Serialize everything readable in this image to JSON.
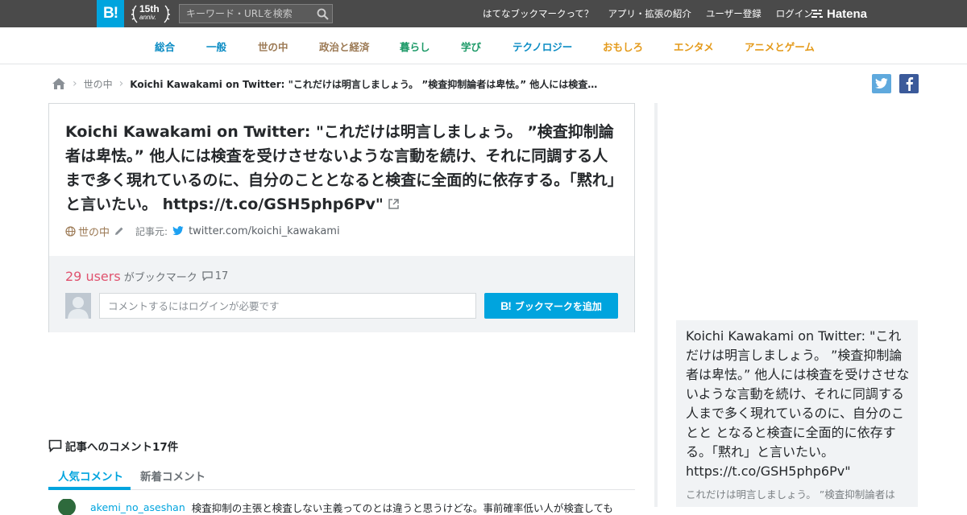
{
  "header": {
    "logo_text": "B!",
    "anniv_number": "15th",
    "anniv_text": "anniv.",
    "search_placeholder": "キーワード・URLを検索",
    "links": [
      "はてなブックマークって？",
      "アプリ・拡張の紹介",
      "ユーザー登録",
      "ログイン"
    ],
    "hatena_logo": "Hatena",
    "bar_color": "#4a4a4a",
    "accent": "#00a4de"
  },
  "categories": [
    {
      "label": "総合",
      "color": "#0b8cc4"
    },
    {
      "label": "一般",
      "color": "#0b8cc4"
    },
    {
      "label": "世の中",
      "color": "#9c7a55"
    },
    {
      "label": "政治と経済",
      "color": "#9c7a55"
    },
    {
      "label": "暮らし",
      "color": "#1d9a68"
    },
    {
      "label": "学び",
      "color": "#1d9a68"
    },
    {
      "label": "テクノロジー",
      "color": "#0b8cc4"
    },
    {
      "label": "おもしろ",
      "color": "#e49a1a"
    },
    {
      "label": "エンタメ",
      "color": "#e49a1a"
    },
    {
      "label": "アニメとゲーム",
      "color": "#e49a1a"
    }
  ],
  "breadcrumb": {
    "home_icon": "home-icon",
    "category": "世の中",
    "current": "Koichi Kawakami on Twitter: \"これだけは明言しましょう。 ”検査抑制論者は卑怯。” 他人には検査を受けさせないような言動を続け、それに同調する人まで多く現れているのに、自分のこととなると検査に全面的に依存する。「黙れ」と言いたい。 https://t.co/GSH5php6Pv\""
  },
  "entry": {
    "title": "Koichi Kawakami on Twitter: \"これだけは明言しましょう。 ”検査抑制論者は卑怯。” 他人には検査を受けさせないような言動を続け、それに同調する人まで多く現れているのに、自分のこととなると検査に全面的に依存する。「黙れ」と言いたい。 https://t.co/GSH5php6Pv\"",
    "category": "世の中",
    "source_label": "記事元:",
    "source_domain": "twitter.com/koichi_kawakami",
    "users_count": "29 users",
    "users_label": "がブックマーク",
    "comment_count": "17",
    "comment_placeholder": "コメントするにはログインが必要です",
    "add_button_icon": "B!",
    "add_button_label": "ブックマークを追加"
  },
  "side": {
    "title": "Koichi Kawakami on Twitter: \"これだけは明言しましょう。 ”検査抑制論者は卑怯。” 他人には検査を受けさせないような言動を続け、それに同調する人まで多く現れているのに、自分のことと\nとなると検査に全面的に依存する。「黙れ」と言いたい。 https://t.co/GSH5php6Pv\"",
    "snippet": "これだけは明言しましょう。 ”検査抑制論者は"
  },
  "comments": {
    "heading": "記事へのコメント17件",
    "tabs": [
      "人気コメント",
      "新着コメント"
    ],
    "first": {
      "user": "akemi_no_aseshan",
      "text": "検査抑制の主張と検査しない主義ってのとは違うと思うけどな。事前確率低い人が検査しても"
    }
  }
}
